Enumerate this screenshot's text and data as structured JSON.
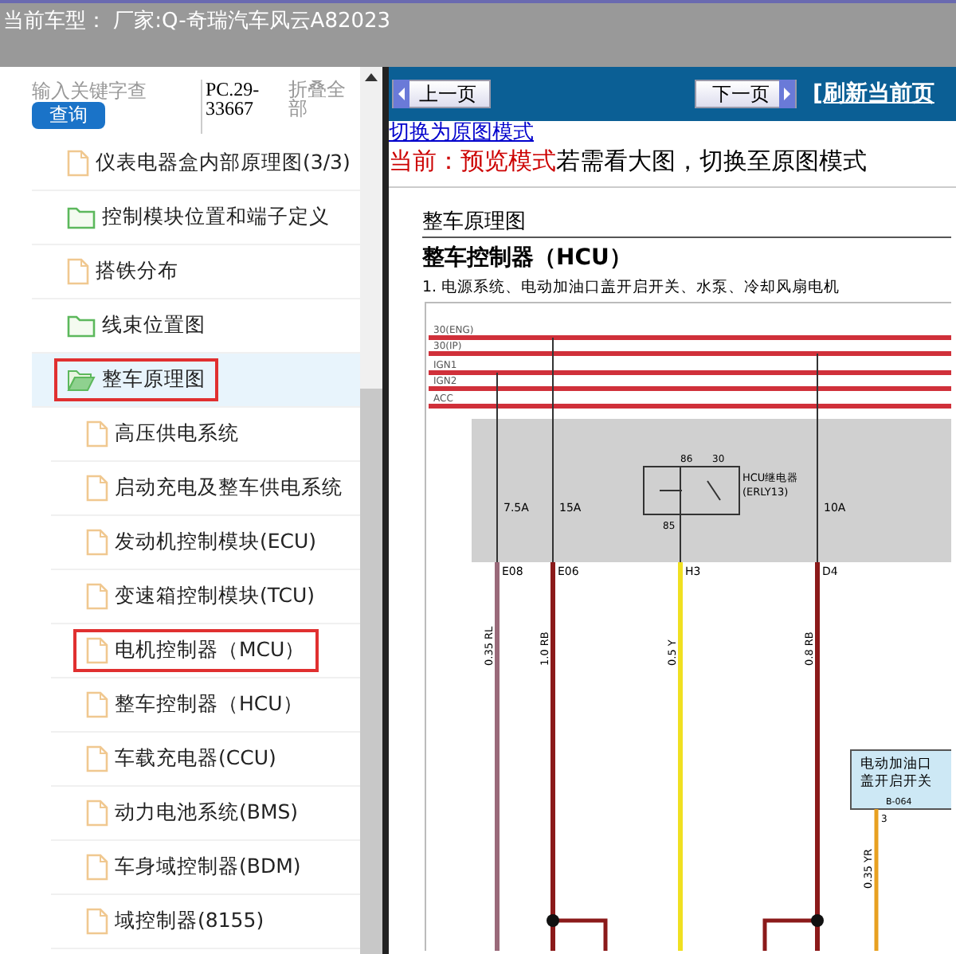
{
  "title_bar": {
    "text": "当前车型： 厂家:Q-奇瑞汽车风云A82023"
  },
  "sidebar": {
    "search": {
      "placeholder": "输入关键字查",
      "button": "查询"
    },
    "code": "PC.29-33667",
    "collapse_all": "折叠全部",
    "tree": [
      {
        "label": "仪表电器盒内部原理图(3/3)",
        "kind": "file",
        "selected": false,
        "highlighted": false
      },
      {
        "label": "控制模块位置和端子定义",
        "kind": "folder",
        "expanded": false,
        "selected": false,
        "highlighted": false
      },
      {
        "label": "搭铁分布",
        "kind": "file",
        "selected": false,
        "highlighted": false
      },
      {
        "label": "线束位置图",
        "kind": "folder",
        "expanded": false,
        "selected": false,
        "highlighted": false
      },
      {
        "label": "整车原理图",
        "kind": "folder",
        "expanded": true,
        "selected": true,
        "highlighted": true,
        "children": [
          {
            "label": "高压供电系统",
            "kind": "file",
            "selected": false,
            "highlighted": false
          },
          {
            "label": "启动充电及整车供电系统",
            "kind": "file",
            "selected": false,
            "highlighted": false
          },
          {
            "label": "发动机控制模块(ECU)",
            "kind": "file",
            "selected": false,
            "highlighted": false
          },
          {
            "label": "变速箱控制模块(TCU)",
            "kind": "file",
            "selected": false,
            "highlighted": false
          },
          {
            "label": "电机控制器（MCU）",
            "kind": "file",
            "selected": false,
            "highlighted": true
          },
          {
            "label": "整车控制器（HCU）",
            "kind": "file",
            "selected": false,
            "highlighted": false
          },
          {
            "label": "车载充电器(CCU)",
            "kind": "file",
            "selected": false,
            "highlighted": false
          },
          {
            "label": "动力电池系统(BMS)",
            "kind": "file",
            "selected": false,
            "highlighted": false
          },
          {
            "label": "车身域控制器(BDM)",
            "kind": "file",
            "selected": false,
            "highlighted": false
          },
          {
            "label": "域控制器(8155)",
            "kind": "file",
            "selected": false,
            "highlighted": false
          }
        ]
      }
    ]
  },
  "toolbar": {
    "prev": "上一页",
    "next": "下一页",
    "refresh": "[刷新当前页"
  },
  "mode_link": "切换为原图模式",
  "mode_notice": {
    "current": "当前：预览模式",
    "hint": "若需看大图，切换至原图模式"
  },
  "document": {
    "section_title": "整车原理图",
    "title": "整车控制器（HCU）",
    "subtitle": "1. 电源系统、电动加油口盖开启开关、水泵、冷却风扇电机",
    "bus_lines": [
      "30(ENG)",
      "30(IP)",
      "IGN1",
      "IGN2",
      "ACC"
    ],
    "relay": {
      "name": "HCU继电器",
      "code": "(ERLY13)",
      "pins": [
        "86",
        "30",
        "85"
      ]
    },
    "wires": [
      {
        "fuse": "7.5A",
        "pin": "E08",
        "label": "0.35 RL",
        "color": "#9a6a7a"
      },
      {
        "fuse": "15A",
        "pin": "E06",
        "label": "1.0 RB",
        "color": "#8b1a1a"
      },
      {
        "pin": "H3",
        "label": "0.5 Y",
        "color": "#f0e020"
      },
      {
        "fuse": "10A",
        "pin": "D4",
        "label": "0.8 RB",
        "color": "#8b1a1a"
      }
    ],
    "connector": {
      "name": [
        "电动加油口",
        "盖开启开关"
      ],
      "code": "B-064",
      "pin": "3",
      "wire_label": "0.35 YR"
    }
  }
}
